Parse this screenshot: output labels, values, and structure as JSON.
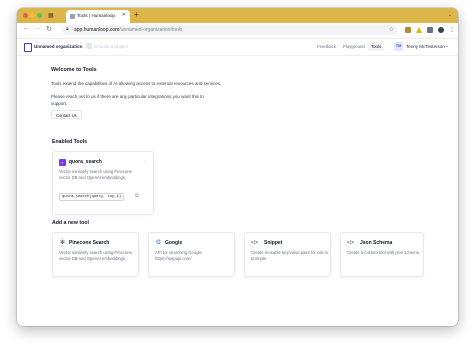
{
  "browser": {
    "tab_title": "Tools | Humanloop",
    "new_tab_icon": "plus-icon",
    "url_host": "app.humanloop.com",
    "url_path": "/unnamed-organization/tools"
  },
  "header": {
    "org_name": "Unnamed organization",
    "project_placeholder": "Choose a project",
    "nav": [
      "Feedback",
      "Playground",
      "Tools"
    ],
    "active_nav": "Tools",
    "user_initials": "TM",
    "user_name": "Teony McTesterson"
  },
  "intro": {
    "title": "Welcome to Tools",
    "p1": "Tools extend the capabilities of AI allowing access to external resources and services.",
    "p2": "Please reach out to us if there are any particular integrations you want this to support.",
    "contact_label": "Contact Us"
  },
  "enabled_section": {
    "title": "Enabled Tools",
    "tools": [
      {
        "name": "quora_search",
        "description": "Vector similarity search using Pinecone vector DB and OpenAI embeddings.",
        "signature": "quora_search(query, top_k)"
      }
    ]
  },
  "add_section": {
    "title": "Add a new tool",
    "tools": [
      {
        "name": "Pinecone Search",
        "icon": "pinecone-icon",
        "description": "Vector similarity search using Pinecone vector DB and OpenAI embeddings."
      },
      {
        "name": "Google",
        "icon": "google-icon",
        "description": "API for searching Google https://serpapi.com/"
      },
      {
        "name": "Snippet",
        "icon": "code-icon",
        "description": "Create reusable key/value pairs for use in prompts"
      },
      {
        "name": "Json Schema",
        "icon": "code-icon",
        "description": "Create a custom tool with json schema"
      }
    ]
  },
  "colors": {
    "accent": "#7c3aed",
    "tab_strip": "#dcb64a"
  }
}
